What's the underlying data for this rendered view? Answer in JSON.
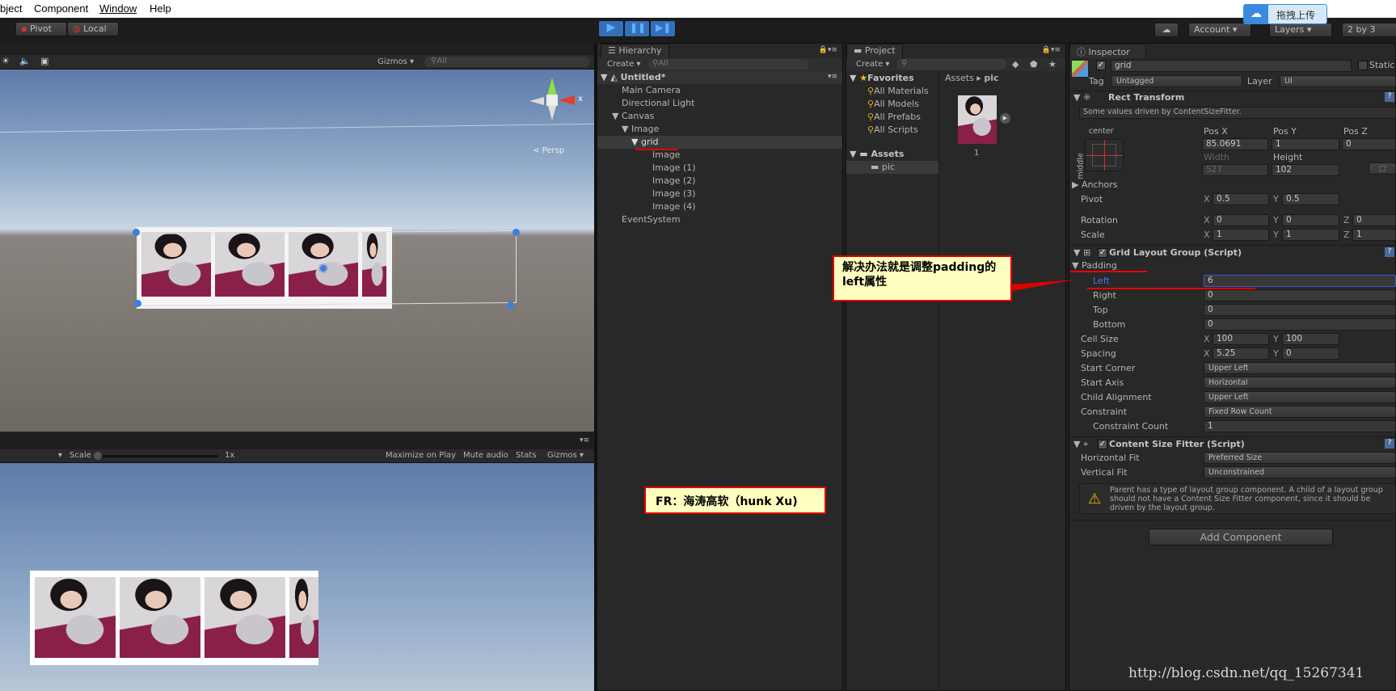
{
  "menu": [
    "bject",
    "Component",
    "Window",
    "Help"
  ],
  "toolbar": {
    "pivot": "Pivot",
    "local": "Local",
    "account": "Account",
    "layers": "Layers",
    "layout": "2 by 3",
    "upload": "拖拽上传",
    "play_icon": "play-icon",
    "pause_icon": "pause-icon",
    "step_icon": "step-icon",
    "cloud_icon": "cloud-icon"
  },
  "scene": {
    "gizmos": "Gizmos",
    "search": "All",
    "persp": "Persp",
    "x_label": "x"
  },
  "game": {
    "scale_label": "Scale",
    "scale_value": "1x",
    "scale_fraction": 0,
    "maximize": "Maximize on Play",
    "mute": "Mute audio",
    "stats": "Stats",
    "gizmos": "Gizmos"
  },
  "hierarchy": {
    "title": "Hierarchy",
    "create": "Create",
    "search": "All",
    "scene": "Untitled*",
    "items": [
      {
        "label": "Main Camera"
      },
      {
        "label": "Directional Light"
      },
      {
        "label": "Canvas"
      },
      {
        "label": "Image"
      },
      {
        "label": "grid"
      },
      {
        "label": "Image"
      },
      {
        "label": "Image (1)"
      },
      {
        "label": "Image (2)"
      },
      {
        "label": "Image (3)"
      },
      {
        "label": "Image (4)"
      },
      {
        "label": "EventSystem"
      }
    ]
  },
  "project": {
    "title": "Project",
    "create": "Create",
    "favorites": "Favorites",
    "fav_items": [
      "All Materials",
      "All Models",
      "All Prefabs",
      "All Scripts"
    ],
    "assets": "Assets",
    "folder": "pic",
    "breadcrumb": [
      "Assets",
      "pic"
    ],
    "asset_name": "1"
  },
  "inspector": {
    "title": "Inspector",
    "name": "grid",
    "static": "Static",
    "tag_label": "Tag",
    "tag": "Untagged",
    "layer_label": "Layer",
    "layer": "UI",
    "rect": {
      "title": "Rect Transform",
      "note": "Some values driven by ContentSizeFitter.",
      "anchor_h": "center",
      "anchor_v": "middle",
      "posx_label": "Pos X",
      "posy_label": "Pos Y",
      "posz_label": "Pos Z",
      "posx": "85.0691",
      "posy": "1",
      "posz": "0",
      "width_label": "Width",
      "height_label": "Height",
      "width": "527",
      "height": "102",
      "anchors": "Anchors",
      "pivot": "Pivot",
      "pivot_x": "0.5",
      "pivot_y": "0.5",
      "rotation": "Rotation",
      "rot": [
        "0",
        "0",
        "0"
      ],
      "scale": "Scale",
      "scl": [
        "1",
        "1",
        "1"
      ]
    },
    "grid": {
      "title": "Grid Layout Group (Script)",
      "padding": "Padding",
      "left": "Left",
      "left_v": "6",
      "right": "Right",
      "right_v": "0",
      "top": "Top",
      "top_v": "0",
      "bottom": "Bottom",
      "bottom_v": "0",
      "cell": "Cell Size",
      "cell_x": "100",
      "cell_y": "100",
      "spacing": "Spacing",
      "sp_x": "5.25",
      "sp_y": "0",
      "corner": "Start Corner",
      "corner_v": "Upper Left",
      "axis": "Start Axis",
      "axis_v": "Horizontal",
      "align": "Child Alignment",
      "align_v": "Upper Left",
      "constraint": "Constraint",
      "constraint_v": "Fixed Row Count",
      "count": "Constraint Count",
      "count_v": "1"
    },
    "csf": {
      "title": "Content Size Fitter (Script)",
      "hfit": "Horizontal Fit",
      "hfit_v": "Preferred Size",
      "vfit": "Vertical Fit",
      "vfit_v": "Unconstrained",
      "warning": "Parent has a type of layout group component. A child of a layout group should not have a Content Size Fitter component, since it should be driven by the layout group."
    },
    "add": "Add Component"
  },
  "axes": {
    "x": "X",
    "y": "Y",
    "z": "Z"
  },
  "annotations": {
    "callout": "解决办法就是调整padding的left属性",
    "credit": "FR：海涛高软（hunk Xu)",
    "watermark": "http://blog.csdn.net/qq_15267341"
  },
  "colors": {
    "play_blue": "#3c8df0",
    "callout_bg": "#ffffc0",
    "callout_border": "#e00000",
    "selected_field": "#4a78d8"
  }
}
